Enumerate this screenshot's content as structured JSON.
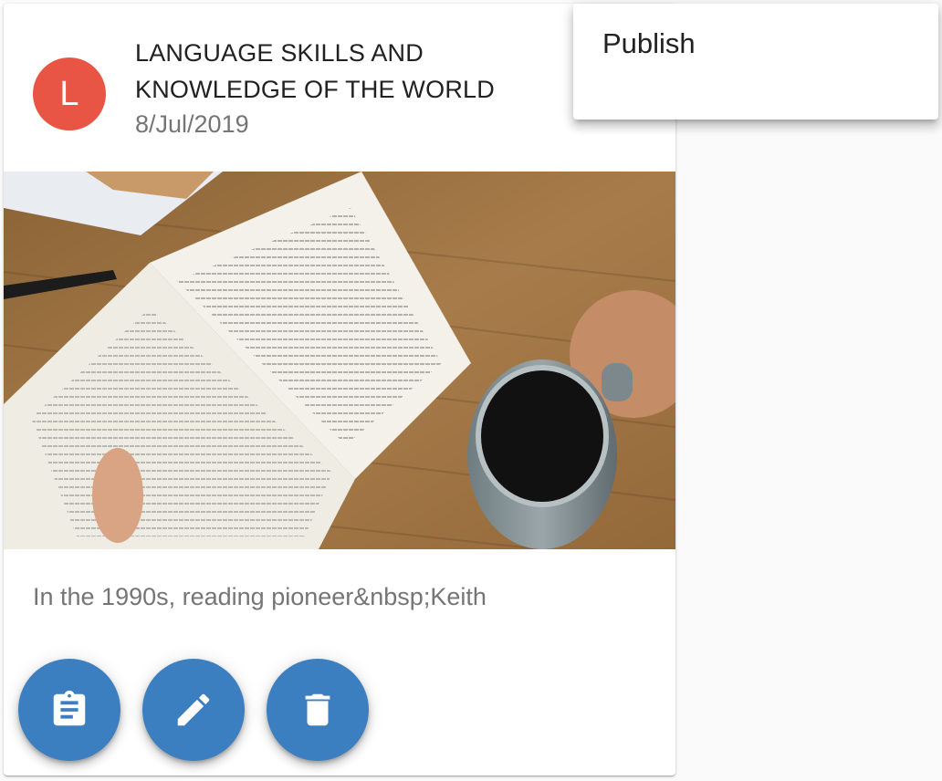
{
  "card": {
    "avatar_letter": "L",
    "title": "LANGUAGE SKILLS AND KNOWLEDGE OF THE WORLD",
    "date": "8/Jul/2019",
    "excerpt": "In the 1990s, reading pioneer&nbsp;Keith",
    "image_description": "Open book at Chapter 8 held in a hand beside a mug of black coffee on a wooden table"
  },
  "actions": [
    {
      "name": "view",
      "icon": "clipboard-icon"
    },
    {
      "name": "edit",
      "icon": "pencil-icon"
    },
    {
      "name": "delete",
      "icon": "trash-icon"
    }
  ],
  "menu": {
    "items": [
      {
        "label": "Publish"
      }
    ]
  },
  "colors": {
    "avatar": "#e85545",
    "fab": "#3b7fc0",
    "background": "#fafafa"
  }
}
